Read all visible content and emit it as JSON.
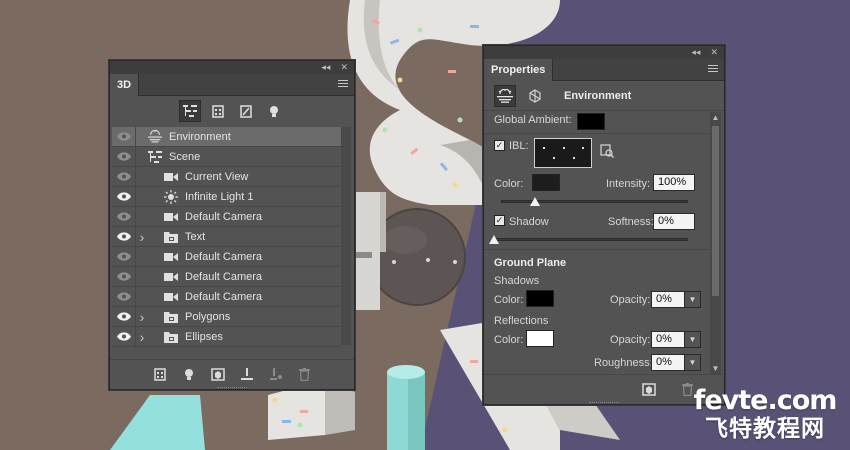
{
  "colors": {
    "canvas_left": "#7a6a60",
    "canvas_right": "#595276",
    "panel_bg": "#535353",
    "selected_row": "#6b6b6b",
    "ambient_swatch": "#000000",
    "ibl_color_swatch": "#1d1d1d",
    "shadows_color_swatch": "#000000",
    "reflections_color_swatch": "#ffffff",
    "cylinder": "#8fd9d4",
    "letter_fill": "#e6e4e1"
  },
  "panel3d": {
    "tab": "3D",
    "filters": [
      {
        "name": "whole-scene-filter-icon",
        "active": true
      },
      {
        "name": "meshes-filter-icon",
        "active": false
      },
      {
        "name": "materials-filter-icon",
        "active": false
      },
      {
        "name": "lights-filter-icon",
        "active": false
      }
    ],
    "layers": [
      {
        "name": "Environment",
        "icon": "environment-icon",
        "indent": 0,
        "expandable": false,
        "visible_eye": "dim",
        "selected": true
      },
      {
        "name": "Scene",
        "icon": "scene-icon",
        "indent": 0,
        "expandable": false,
        "visible_eye": "dim",
        "selected": false
      },
      {
        "name": "Current View",
        "icon": "camera-icon",
        "indent": 1,
        "expandable": false,
        "visible_eye": "dim",
        "selected": false
      },
      {
        "name": "Infinite Light 1",
        "icon": "infinite-light-icon",
        "indent": 1,
        "expandable": false,
        "visible_eye": "bright",
        "selected": false
      },
      {
        "name": "Default Camera",
        "icon": "camera-icon",
        "indent": 1,
        "expandable": false,
        "visible_eye": "dim",
        "selected": false
      },
      {
        "name": "Text",
        "icon": "mesh-folder-icon",
        "indent": 1,
        "expandable": true,
        "visible_eye": "bright",
        "selected": false
      },
      {
        "name": "Default Camera",
        "icon": "camera-icon",
        "indent": 1,
        "expandable": false,
        "visible_eye": "dim",
        "selected": false
      },
      {
        "name": "Default Camera",
        "icon": "camera-icon",
        "indent": 1,
        "expandable": false,
        "visible_eye": "dim",
        "selected": false
      },
      {
        "name": "Default Camera",
        "icon": "camera-icon",
        "indent": 1,
        "expandable": false,
        "visible_eye": "dim",
        "selected": false
      },
      {
        "name": "Polygons",
        "icon": "mesh-folder-icon",
        "indent": 1,
        "expandable": true,
        "visible_eye": "bright",
        "selected": false
      },
      {
        "name": "Ellipses",
        "icon": "mesh-folder-icon",
        "indent": 1,
        "expandable": true,
        "visible_eye": "bright",
        "selected": false
      }
    ],
    "bottom_buttons": [
      "add-mesh-icon",
      "add-light-icon",
      "render-icon",
      "drop-to-ground-icon",
      "split-mesh-icon",
      "trash-icon"
    ]
  },
  "properties": {
    "tab": "Properties",
    "header_title": "Environment",
    "global_ambient_label": "Global Ambient:",
    "ibl_label": "IBL:",
    "ibl_checked": true,
    "color_label": "Color:",
    "intensity_label": "Intensity:",
    "intensity_value": "100%",
    "intensity_slider_fraction": 0.18,
    "shadow_label": "Shadow",
    "shadow_checked": true,
    "softness_label": "Softness:",
    "softness_value": "0%",
    "softness_slider_fraction": 0.0,
    "ground_plane_label": "Ground Plane",
    "shadows_section_label": "Shadows",
    "shadows_color_label": "Color:",
    "shadows_opacity_label": "Opacity:",
    "shadows_opacity_value": "0%",
    "reflections_section_label": "Reflections",
    "reflections_color_label": "Color:",
    "reflections_opacity_label": "Opacity:",
    "reflections_opacity_value": "0%",
    "roughness_label": "Roughness:",
    "roughness_value": "0%"
  },
  "watermark": {
    "domain_a": "fevte",
    "domain_b": ".com",
    "chinese": "飞特教程网"
  }
}
